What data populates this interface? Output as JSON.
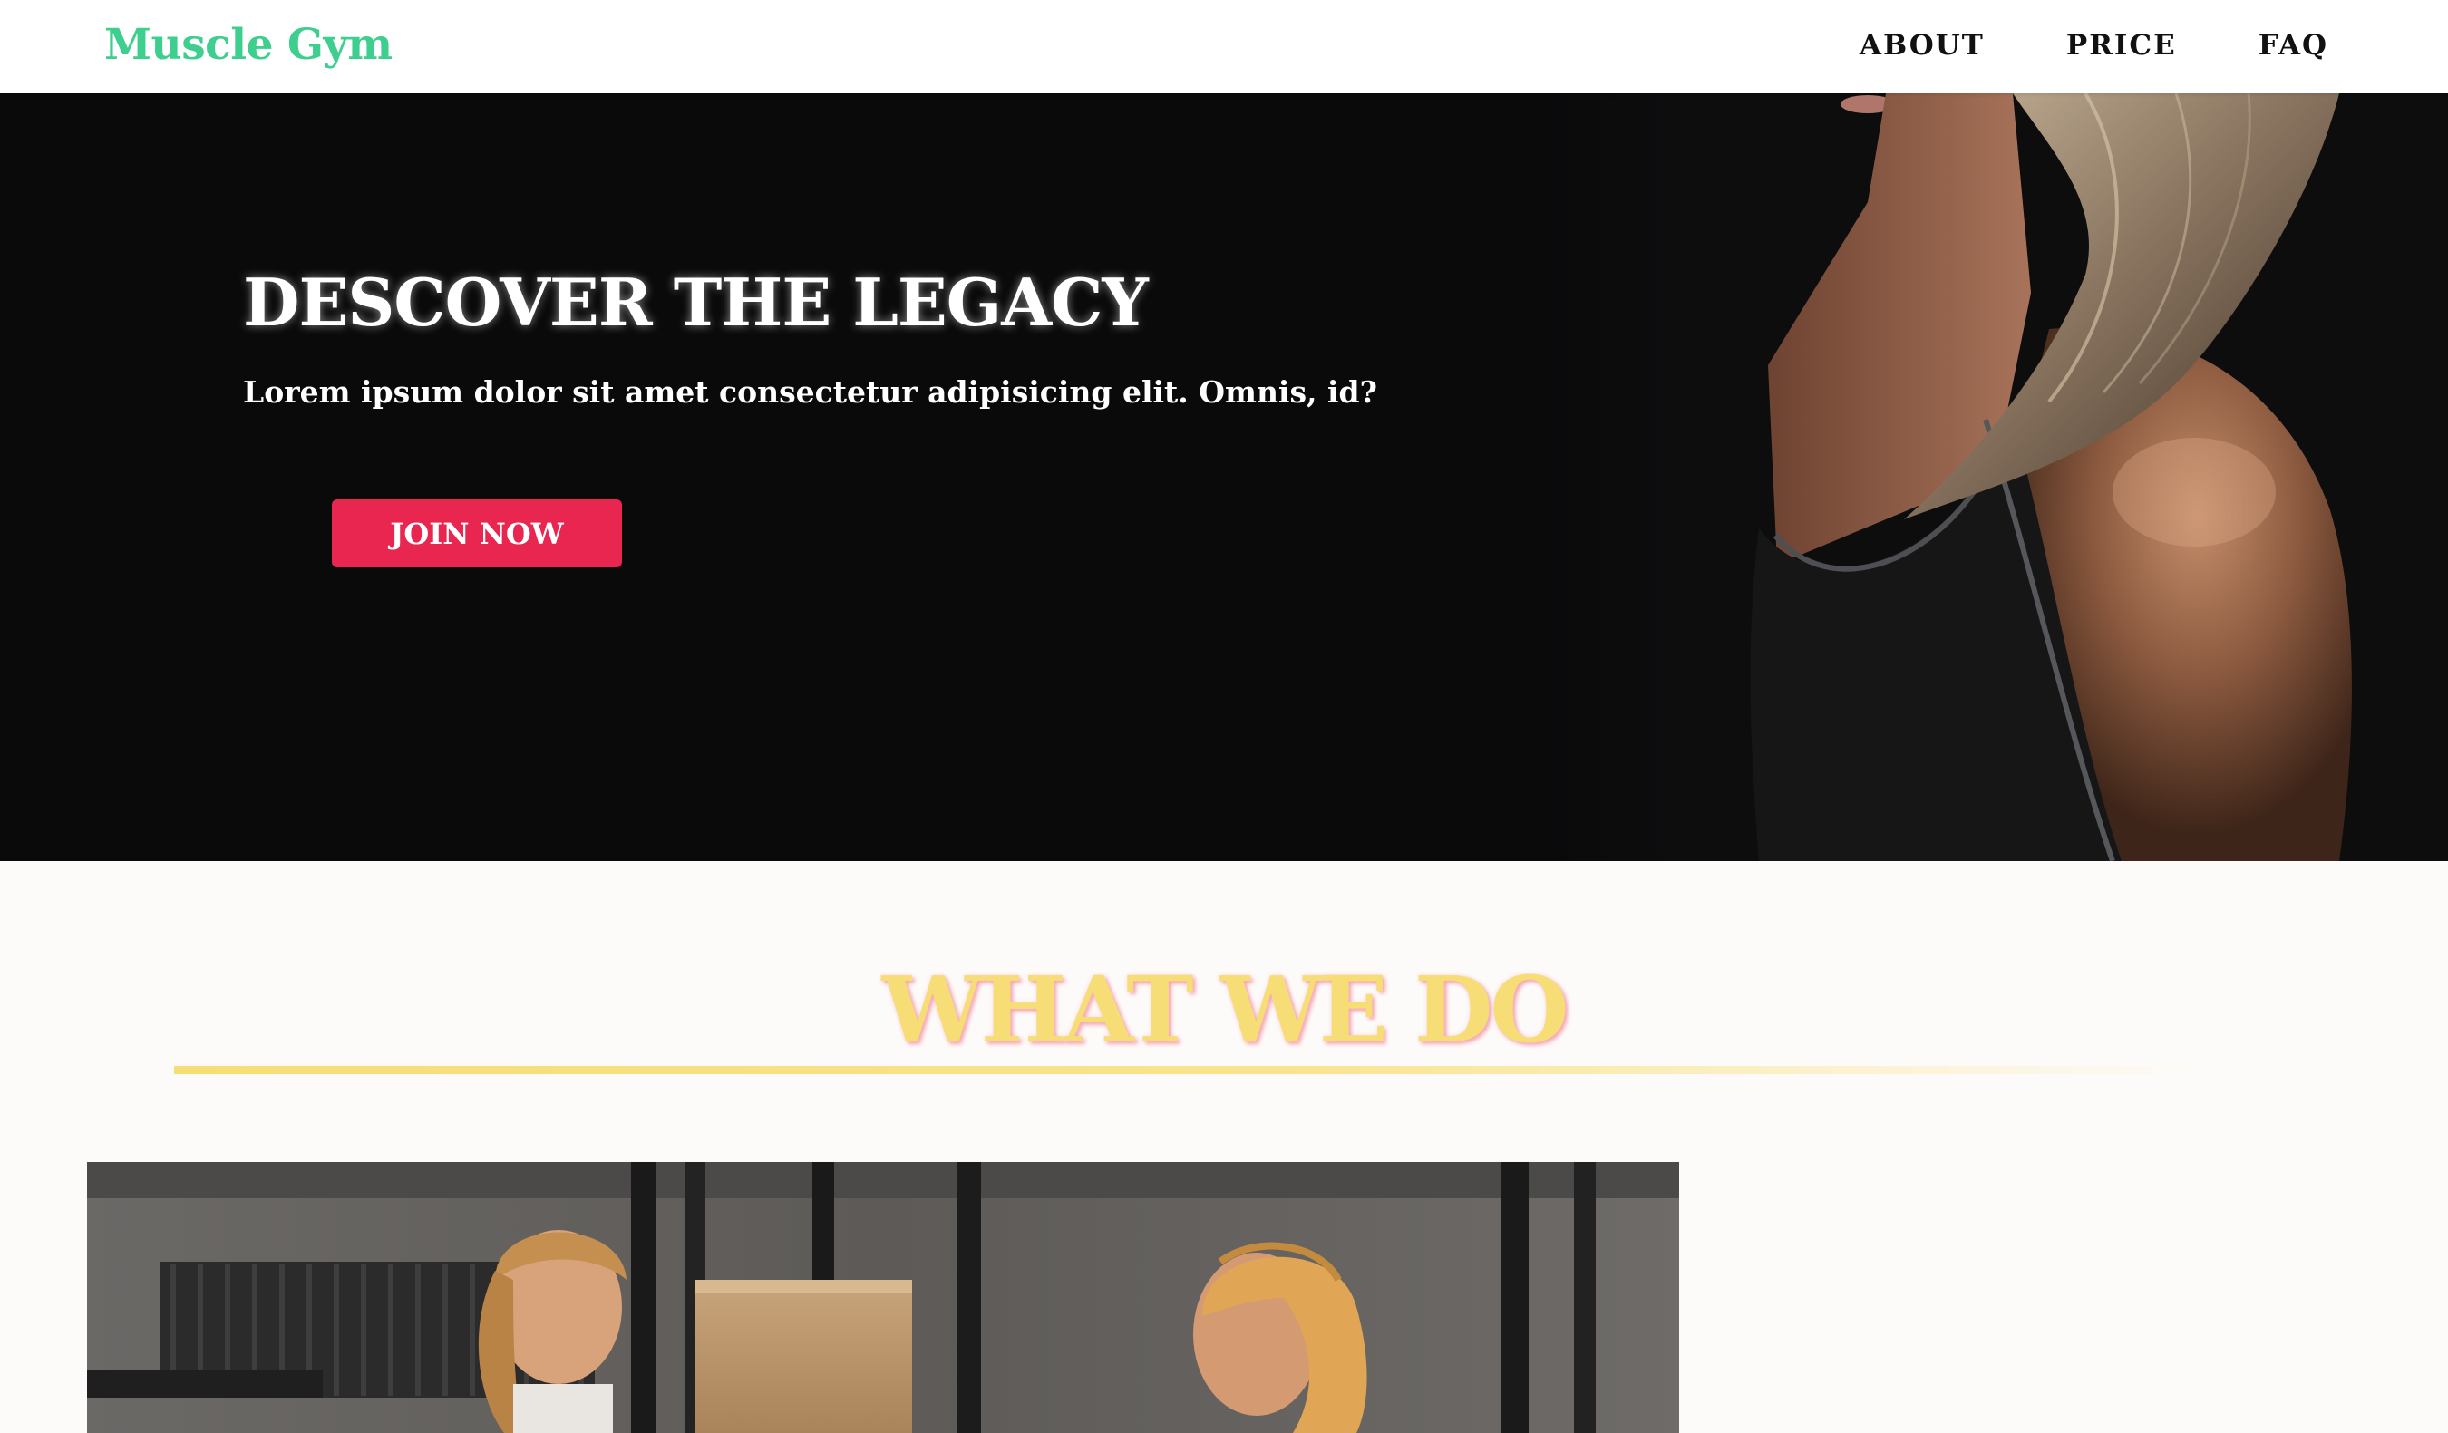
{
  "nav": {
    "logo": "Muscle Gym",
    "links": [
      "ABOUT",
      "PRICE",
      "FAQ"
    ]
  },
  "hero": {
    "title": "DESCOVER THE LEGACY",
    "subtitle": "Lorem ipsum dolor sit amet consectetur adipisicing elit. Omnis, id?",
    "cta_label": "JOIN NOW"
  },
  "section": {
    "title": "WHAT WE DO"
  },
  "colors": {
    "brand_green": "#3ecf8e",
    "cta_red": "#e8264f",
    "accent_yellow": "#f7dd75",
    "hero_bg": "#0a0a0b"
  }
}
